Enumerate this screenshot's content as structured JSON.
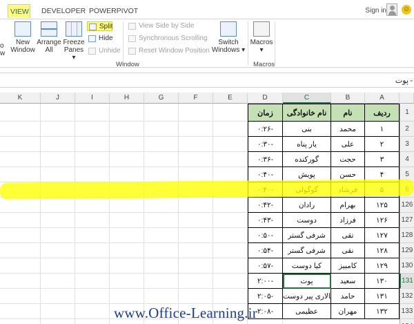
{
  "tabs": {
    "view": "VIEW",
    "developer": "DEVELOPER",
    "powerpivot": "POWERPIVOT"
  },
  "account": {
    "signin": "Sign in"
  },
  "ribbon": {
    "partial_left_1": "o",
    "partial_left_2": "w",
    "new_window": [
      "New",
      "Window"
    ],
    "arrange_all": [
      "Arrange",
      "All"
    ],
    "freeze_panes": [
      "Freeze",
      "Panes ▾"
    ],
    "split": "Split",
    "hide": "Hide",
    "unhide": "Unhide",
    "view_side_by_side": "View Side by Side",
    "sync_scrolling": "Synchronous Scrolling",
    "reset_window": "Reset Window Position",
    "switch_windows": [
      "Switch",
      "Windows ▾"
    ],
    "macros": [
      "Macros",
      "▾"
    ],
    "group_window": "Window",
    "group_macros": "Macros"
  },
  "formula_bar": {
    "value": "پوت"
  },
  "columns": [
    "K",
    "J",
    "I",
    "H",
    "G",
    "F",
    "E",
    "D",
    "C",
    "B",
    "A"
  ],
  "row_headers": [
    "1",
    "2",
    "3",
    "4",
    "5",
    "6",
    "126",
    "127",
    "128",
    "129",
    "130",
    "131",
    "132",
    "133",
    "134"
  ],
  "table": {
    "headers": {
      "id": "ردیف",
      "name": "نام",
      "family": "نام خانوادگی",
      "time": "زمان"
    },
    "rows": [
      {
        "id": "۱",
        "name": "محمد",
        "family": "بنی",
        "time": "۰:۲۶-"
      },
      {
        "id": "۲",
        "name": "علی",
        "family": "یار پناه",
        "time": "۰:۳۰-"
      },
      {
        "id": "۳",
        "name": "حجت",
        "family": "گورکنده",
        "time": "۰:۳۶-"
      },
      {
        "id": "۴",
        "name": "حسن",
        "family": "پویش",
        "time": "۰:۴۰-"
      },
      {
        "id": "۵",
        "name": "فرشاد",
        "family": "گوگولی",
        "time": "۰:۴۰-"
      },
      {
        "id": "۱۲۵",
        "name": "بهرام",
        "family": "رادان",
        "time": "۰:۴۲-"
      },
      {
        "id": "۱۲۶",
        "name": "فرزاد",
        "family": "دوست",
        "time": "۰:۴۳-"
      },
      {
        "id": "۱۲۷",
        "name": "تقی",
        "family": "شرفی گستر",
        "time": "۰:۵۰-"
      },
      {
        "id": "۱۲۸",
        "name": "نقی",
        "family": "شرفی گستر",
        "time": "۰:۵۴-"
      },
      {
        "id": "۱۲۹",
        "name": "کامبیز",
        "family": "کیا دوست",
        "time": "۰:۵۷-"
      },
      {
        "id": "۱۳۰",
        "name": "سعید",
        "family": "پوت",
        "time": "۲:۰۰-"
      },
      {
        "id": "۱۳۱",
        "name": "حامد",
        "family": "سالاری پیر دوست",
        "time": "۲:۰۵-"
      },
      {
        "id": "۱۳۲",
        "name": "مهران",
        "family": "عظیمی",
        "time": "۲:۰۸-"
      }
    ]
  },
  "watermark": "www.Office-Learning.ir",
  "colors": {
    "header_fill": "#c5e0b4",
    "highlight": "#ffff00",
    "excel_green": "#217346",
    "watermark": "#1a3c8f"
  }
}
